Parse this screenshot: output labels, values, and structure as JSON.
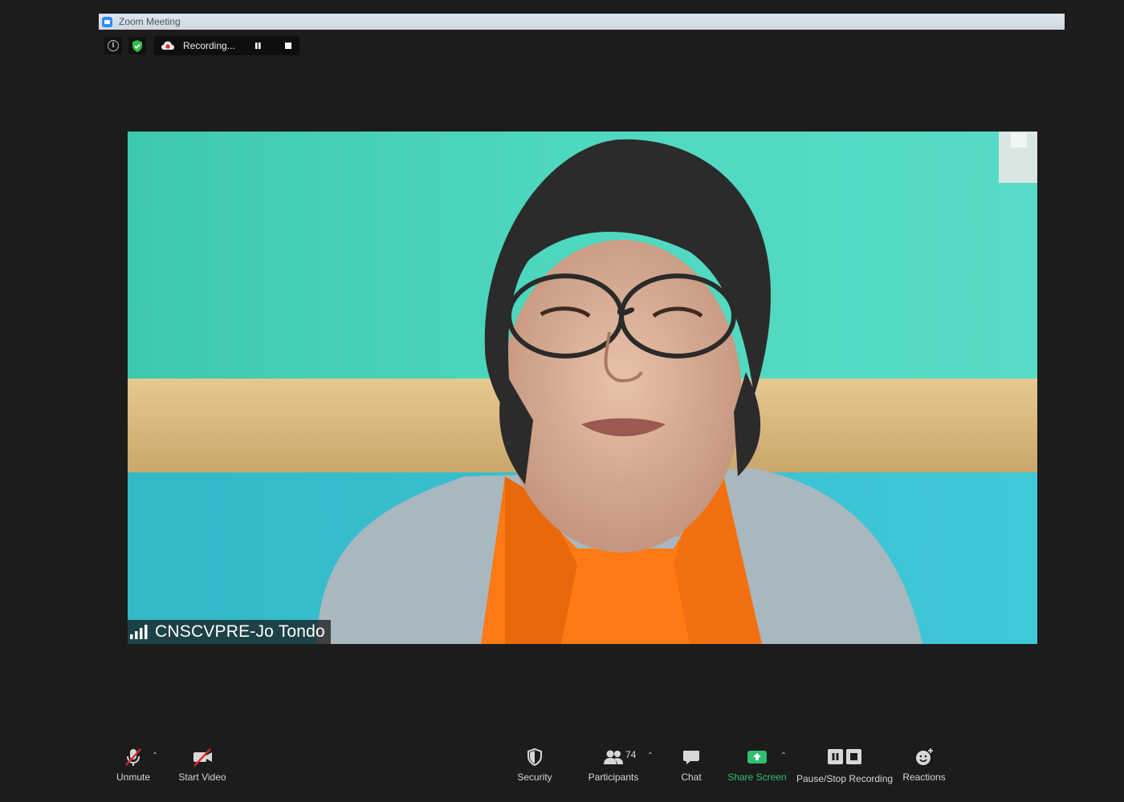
{
  "window": {
    "title": "Zoom Meeting"
  },
  "top_bar": {
    "recording_label": "Recording..."
  },
  "video": {
    "participant_name": "CNSCVPRE-Jo Tondo"
  },
  "toolbar": {
    "unmute_label": "Unmute",
    "start_video_label": "Start Video",
    "security_label": "Security",
    "participants_label": "Participants",
    "participants_count": "74",
    "chat_label": "Chat",
    "share_screen_label": "Share Screen",
    "recording_label": "Pause/Stop Recording",
    "reactions_label": "Reactions"
  },
  "colors": {
    "background": "#1c1c1c",
    "share_green": "#2fbf71",
    "zoom_blue": "#2d8cff",
    "mute_red": "#e02828"
  }
}
